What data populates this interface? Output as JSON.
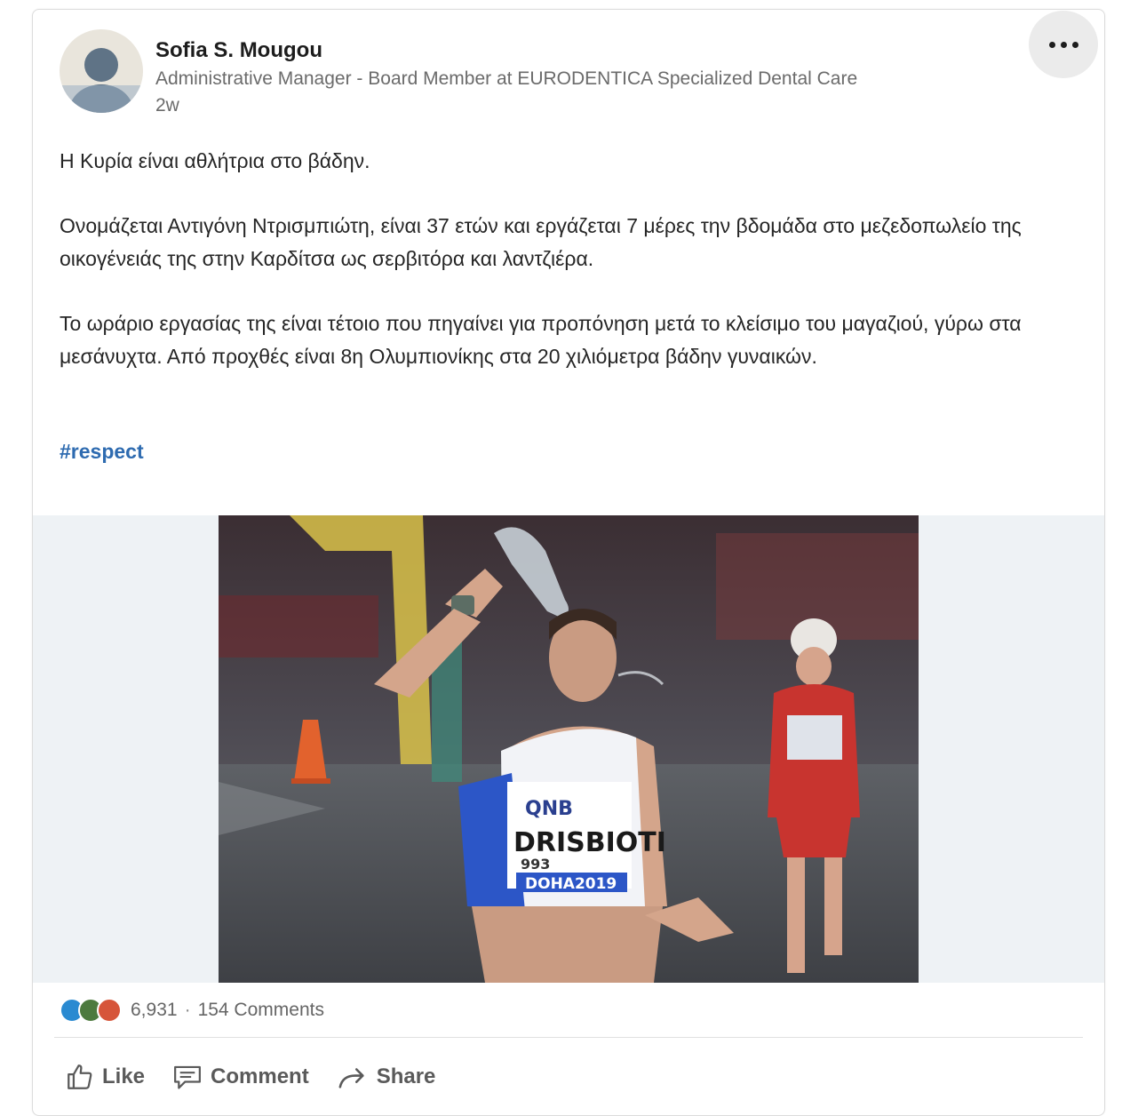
{
  "post": {
    "author": {
      "name": "Sofia S. Mougou",
      "headline": "Administrative Manager - Board Member at EURODENTICA Specialized Dental Care",
      "time": "2w"
    },
    "paragraphs": [
      "Η Κυρία είναι αθλήτρια στο βάδην.",
      "Ονομάζεται Αντιγόνη Ντρισμπιώτη, είναι 37 ετών και εργάζεται 7 μέρες την βδομάδα στο μεζεδοπωλείο της οικογένειάς της στην Καρδίτσα ως σερβιτόρα και λαντζιέρα.",
      "Το ωράριο εργασίας της είναι τέτοιο που πηγαίνει για προπόνηση μετά το κλείσιμο του μαγαζιού, γύρω στα μεσάνυχτα. Από προχθές είναι 8η Ολυμπιονίκης στα 20 χιλιόμετρα βάδην γυναικών."
    ],
    "hashtag": "#respect",
    "image": {
      "bib_sponsor": "QNB",
      "bib_name": "DRISBIOTI",
      "bib_number": "993",
      "bib_event": "DOHA2019"
    }
  },
  "social": {
    "reactions_count": "6,931",
    "separator": "·",
    "comments": "154 Comments",
    "reaction_colors": [
      "#2a8ad1",
      "#4d7a3e",
      "#d6553a"
    ]
  },
  "actions": {
    "like": "Like",
    "comment": "Comment",
    "share": "Share"
  }
}
